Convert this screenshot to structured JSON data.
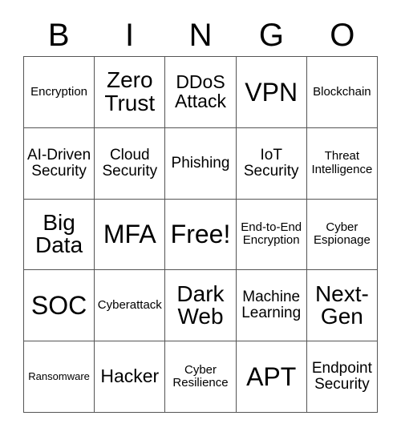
{
  "card": {
    "title": "BINGO",
    "header_letters": [
      "B",
      "I",
      "N",
      "G",
      "O"
    ],
    "grid_line_color": "#555555",
    "text_color": "#000000",
    "background_color": "#ffffff",
    "rows": 5,
    "columns": 5,
    "free_space_label": "Free!",
    "free_space_position": "row3-col3",
    "cells": [
      [
        {
          "label": "Encryption",
          "size": "sm"
        },
        {
          "label": "Zero Trust",
          "size": "xl"
        },
        {
          "label": "DDoS Attack",
          "size": "lg"
        },
        {
          "label": "VPN",
          "size": "xxl"
        },
        {
          "label": "Blockchain",
          "size": "sm"
        }
      ],
      [
        {
          "label": "AI-Driven Security",
          "size": "md"
        },
        {
          "label": "Cloud Security",
          "size": "md"
        },
        {
          "label": "Phishing",
          "size": "md"
        },
        {
          "label": "IoT Security",
          "size": "md"
        },
        {
          "label": "Threat Intelligence",
          "size": "sm"
        }
      ],
      [
        {
          "label": "Big Data",
          "size": "xl"
        },
        {
          "label": "MFA",
          "size": "xxl"
        },
        {
          "label": "Free!",
          "size": "xxl"
        },
        {
          "label": "End-to-End Encryption",
          "size": "sm"
        },
        {
          "label": "Cyber Espionage",
          "size": "sm"
        }
      ],
      [
        {
          "label": "SOC",
          "size": "xxl"
        },
        {
          "label": "Cyberattack",
          "size": "sm"
        },
        {
          "label": "Dark Web",
          "size": "xl"
        },
        {
          "label": "Machine Learning",
          "size": "md"
        },
        {
          "label": "Next-Gen",
          "size": "xl"
        }
      ],
      [
        {
          "label": "Ransomware",
          "size": "xs"
        },
        {
          "label": "Hacker",
          "size": "lg"
        },
        {
          "label": "Cyber Resilience",
          "size": "sm"
        },
        {
          "label": "APT",
          "size": "xxl"
        },
        {
          "label": "Endpoint Security",
          "size": "md"
        }
      ]
    ]
  }
}
